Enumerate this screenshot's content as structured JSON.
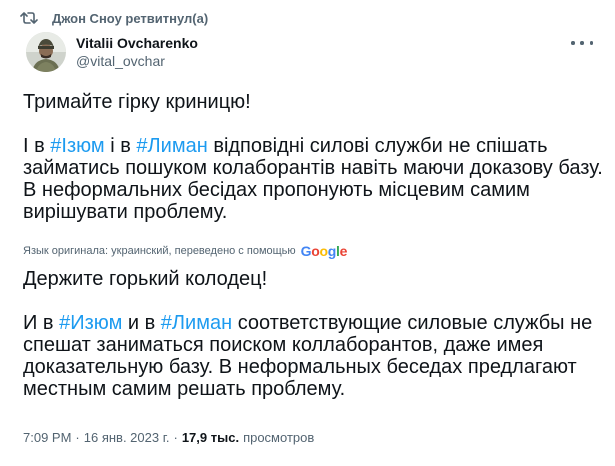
{
  "retweet": {
    "text": "Джон Сноу ретвитнул(а)",
    "icon": "retweet-icon"
  },
  "author": {
    "display_name": "Vitalii Ovcharenko",
    "handle": "@vital_ovchar",
    "avatar": "soldier-avatar"
  },
  "menu": {
    "icon": "more-icon"
  },
  "original": {
    "line1": "Тримайте гірку криницю!",
    "p2_pre": "І в ",
    "hashtag1": "#Ізюм",
    "p2_mid": " і в ",
    "hashtag2": "#Лиман",
    "p2_post": " відповідні силові служби не спішать займатись пошуком колаборантів навіть маючи доказову базу. В неформальних бесідах пропонують місцевим самим вирішувати проблему."
  },
  "translation_note": {
    "text": "Язык оригинала: украинский, переведено с помощью",
    "provider": "Google",
    "provider_colors": [
      "#4285F4",
      "#EA4335",
      "#FBBC05",
      "#4285F4",
      "#34A853",
      "#EA4335"
    ]
  },
  "translated": {
    "line1": "Держите горький колодец!",
    "p2_pre": "И в ",
    "hashtag1": "#Изюм",
    "p2_mid": " и в ",
    "hashtag2": "#Лиман",
    "p2_post": " соответствующие силовые службы не спешат заниматься поиском коллаборантов, даже имея доказательную базу. В неформальных беседах предлагают местным самим решать проблему."
  },
  "meta": {
    "time": "7:09 PM",
    "separator": "·",
    "date": "16 янв. 2023 г.",
    "views": "17,9 тыс.",
    "views_label": "просмотров"
  },
  "colors": {
    "accent": "#1d9bf0",
    "text": "#0f1419",
    "secondary": "#536471"
  }
}
